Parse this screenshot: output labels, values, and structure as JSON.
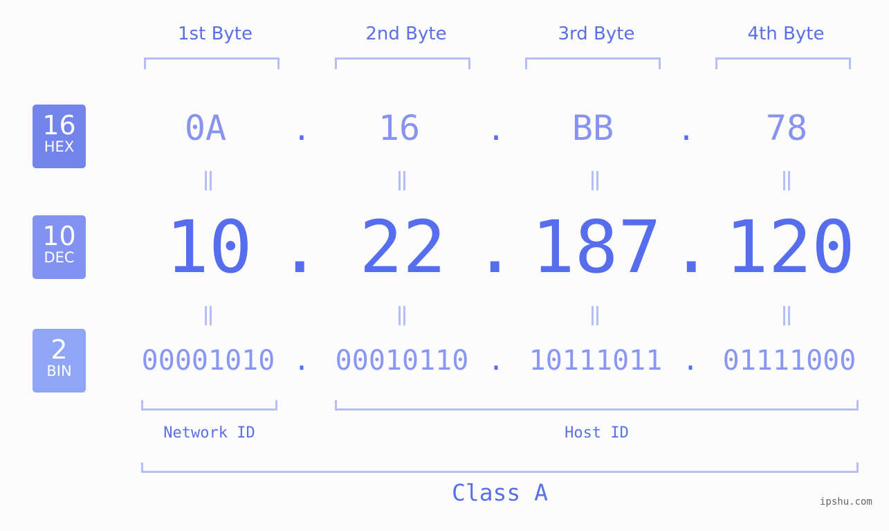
{
  "headers": [
    "1st Byte",
    "2nd Byte",
    "3rd Byte",
    "4th Byte"
  ],
  "badges": [
    {
      "num": "16",
      "label": "HEX",
      "color": "#7384ec"
    },
    {
      "num": "10",
      "label": "DEC",
      "color": "#8292f1"
    },
    {
      "num": "2",
      "label": "BIN",
      "color": "#8fa6f7"
    }
  ],
  "hex": [
    "0A",
    "16",
    "BB",
    "78"
  ],
  "dec": [
    "10",
    "22",
    "187",
    "120"
  ],
  "bin": [
    "00001010",
    "00010110",
    "10111011",
    "01111000"
  ],
  "separator": ".",
  "network_label": "Network ID",
  "host_label": "Host ID",
  "class_label": "Class A",
  "watermark": "ipshu.com"
}
